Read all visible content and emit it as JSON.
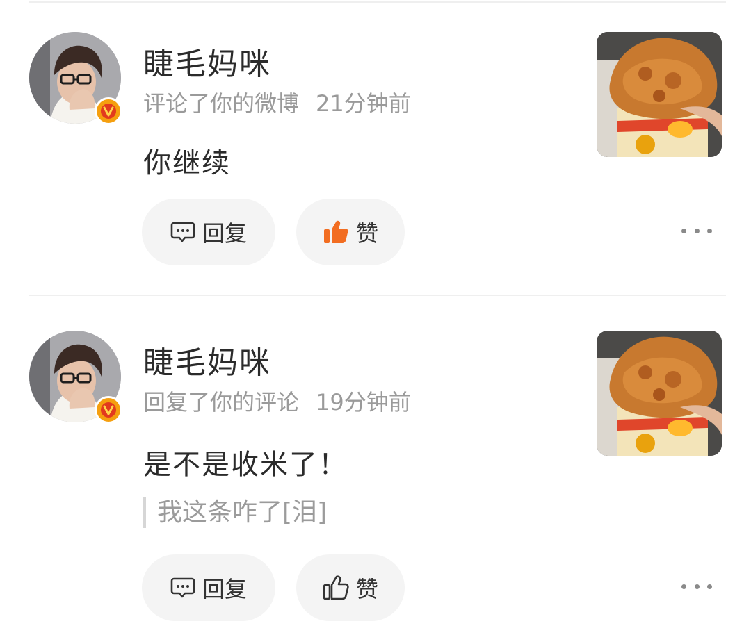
{
  "notifications": [
    {
      "username": "睫毛妈咪",
      "action": "评论了你的微博",
      "time": "21分钟前",
      "content": "你继续",
      "quote": "",
      "reply_label": "回复",
      "like_label": "赞",
      "liked": true
    },
    {
      "username": "睫毛妈咪",
      "action": "回复了你的评论",
      "time": "19分钟前",
      "content": "是不是收米了！",
      "quote": "我这条咋了[泪]",
      "reply_label": "回复",
      "like_label": "赞",
      "liked": false
    }
  ],
  "colors": {
    "like_active": "#f26d21",
    "badge": "#f59f0f",
    "meta_text": "#9a9a9a"
  }
}
